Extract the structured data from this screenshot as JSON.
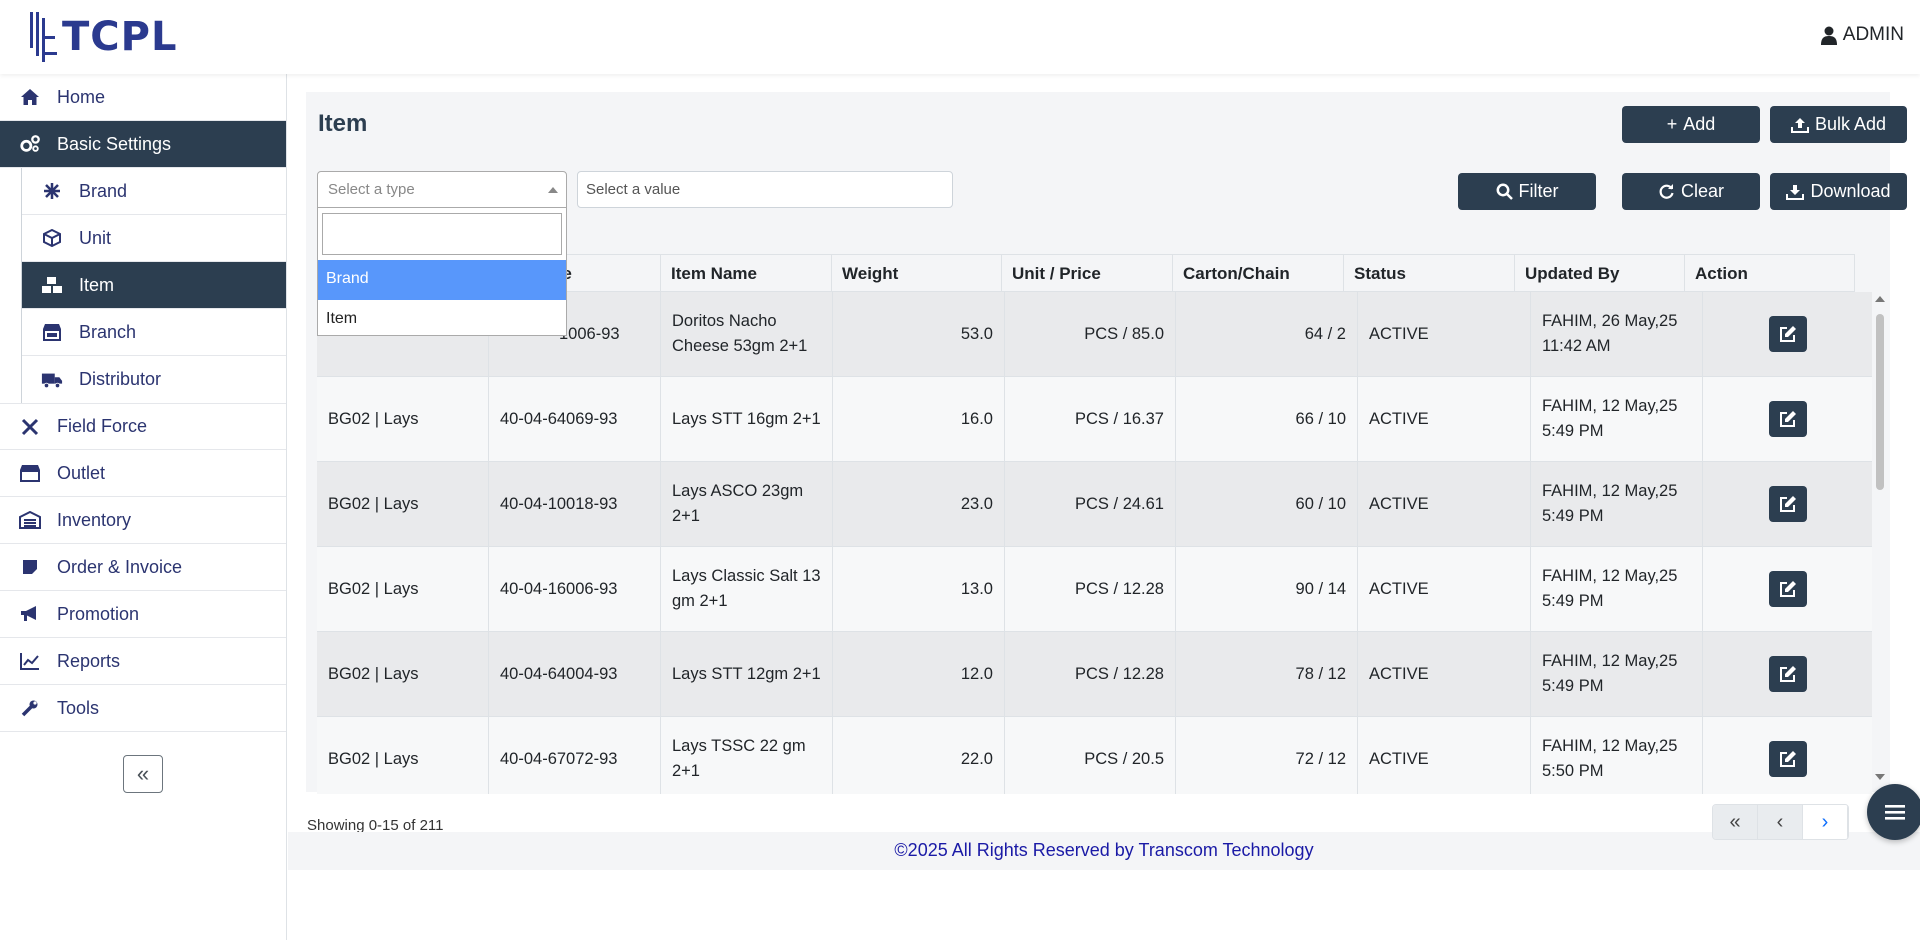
{
  "header": {
    "brand": "TCPL",
    "user": "ADMIN"
  },
  "sidebar": {
    "items": [
      {
        "label": "Home",
        "icon": "home-icon"
      },
      {
        "label": "Basic Settings",
        "icon": "gears-icon"
      },
      {
        "label": "Field Force",
        "icon": "tools-cross-icon"
      },
      {
        "label": "Outlet",
        "icon": "store-icon"
      },
      {
        "label": "Inventory",
        "icon": "warehouse-icon"
      },
      {
        "label": "Order & Invoice",
        "icon": "sticky-note-icon"
      },
      {
        "label": "Promotion",
        "icon": "megaphone-icon"
      },
      {
        "label": "Reports",
        "icon": "chart-line-icon"
      },
      {
        "label": "Tools",
        "icon": "wrench-icon"
      }
    ],
    "sub_items": [
      {
        "label": "Brand",
        "icon": "brand-icon"
      },
      {
        "label": "Unit",
        "icon": "cube-icon"
      },
      {
        "label": "Item",
        "icon": "boxes-icon"
      },
      {
        "label": "Branch",
        "icon": "shop-icon"
      },
      {
        "label": "Distributor",
        "icon": "truck-icon"
      }
    ]
  },
  "page": {
    "title": "Item",
    "add_label": "Add",
    "bulk_add_label": "Bulk Add",
    "filter_label": "Filter",
    "clear_label": "Clear",
    "download_label": "Download",
    "type_placeholder": "Select a type",
    "value_placeholder": "Select a value",
    "dropdown_options": [
      "Brand",
      "Item"
    ]
  },
  "table": {
    "columns": [
      "de",
      "Item Name",
      "Weight",
      "Unit / Price",
      "Carton/Chain",
      "Status",
      "Updated By",
      "Action"
    ],
    "rows": [
      {
        "brand": "",
        "code": "1006-93",
        "name": "Doritos Nacho Cheese 53gm 2+1",
        "weight": "53.0",
        "unit_price": "PCS / 85.0",
        "carton": "64 / 2",
        "status": "ACTIVE",
        "updated": "FAHIM, 26 May,25 11:42 AM"
      },
      {
        "brand": "BG02 | Lays",
        "code": "40-04-64069-93",
        "name": "Lays STT 16gm 2+1",
        "weight": "16.0",
        "unit_price": "PCS / 16.37",
        "carton": "66 / 10",
        "status": "ACTIVE",
        "updated": "FAHIM, 12 May,25 5:49 PM"
      },
      {
        "brand": "BG02 | Lays",
        "code": "40-04-10018-93",
        "name": "Lays ASCO 23gm 2+1",
        "weight": "23.0",
        "unit_price": "PCS / 24.61",
        "carton": "60 / 10",
        "status": "ACTIVE",
        "updated": "FAHIM, 12 May,25 5:49 PM"
      },
      {
        "brand": "BG02 | Lays",
        "code": "40-04-16006-93",
        "name": "Lays Classic Salt 13 gm 2+1",
        "weight": "13.0",
        "unit_price": "PCS / 12.28",
        "carton": "90 / 14",
        "status": "ACTIVE",
        "updated": "FAHIM, 12 May,25 5:49 PM"
      },
      {
        "brand": "BG02 | Lays",
        "code": "40-04-64004-93",
        "name": "Lays STT 12gm 2+1",
        "weight": "12.0",
        "unit_price": "PCS / 12.28",
        "carton": "78 / 12",
        "status": "ACTIVE",
        "updated": "FAHIM, 12 May,25 5:49 PM"
      },
      {
        "brand": "BG02 | Lays",
        "code": "40-04-67072-93",
        "name": "Lays TSSC 22 gm 2+1",
        "weight": "22.0",
        "unit_price": "PCS / 20.5",
        "carton": "72 / 12",
        "status": "ACTIVE",
        "updated": "FAHIM, 12 May,25 5:50 PM"
      }
    ]
  },
  "pagination": {
    "showing": "Showing 0-15 of 211"
  },
  "footer": {
    "text": "©2025 All Rights Reserved by Transcom Technology"
  },
  "colors": {
    "primary_dark": "#2c3e50",
    "brand_blue": "#2b3a8f",
    "highlight": "#5897fb"
  }
}
